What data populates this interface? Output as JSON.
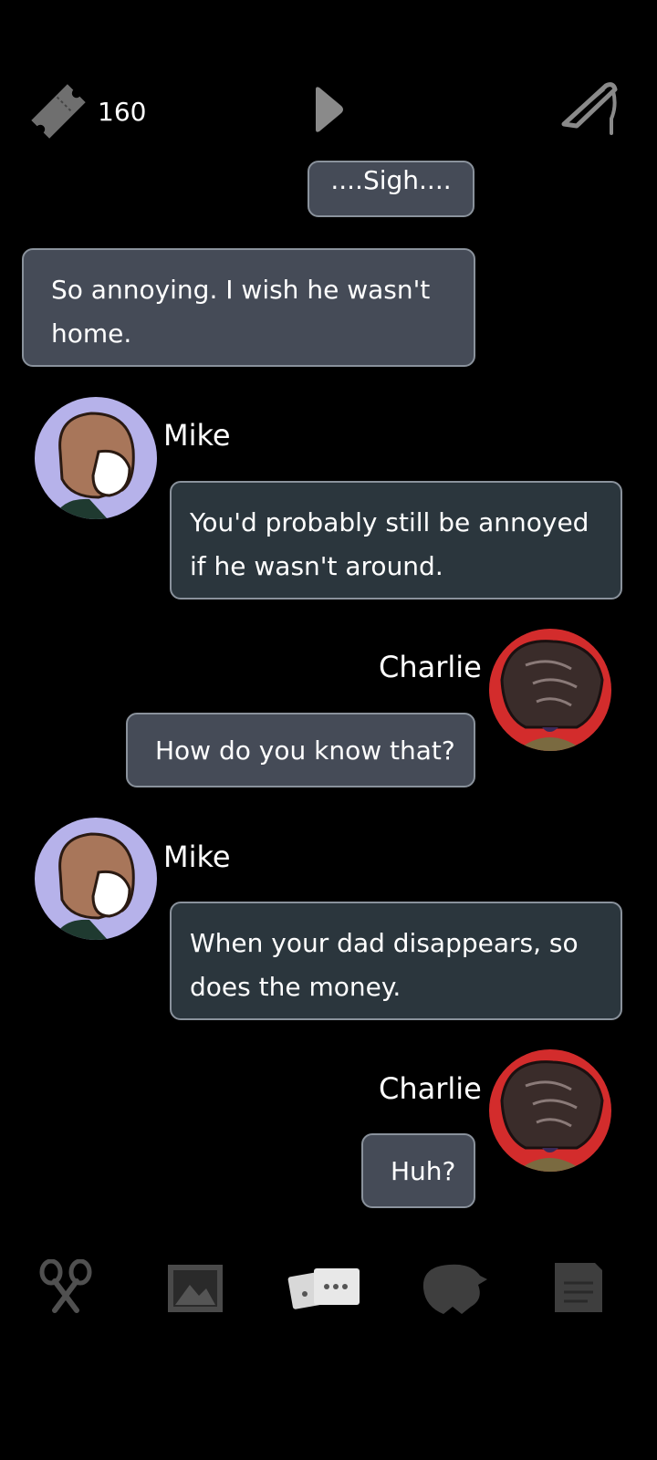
{
  "topbar": {
    "ticket_count": "160",
    "icons": [
      "ticket-icon",
      "play-icon",
      "quill-pen-icon"
    ]
  },
  "chat": {
    "partial_message": "....Sigh....",
    "messages": [
      {
        "speaker": "",
        "side": "self",
        "text": "So annoying. I wish he wasn't\nhome."
      },
      {
        "speaker": "Mike",
        "side": "other",
        "text": "You'd probably still be annoyed\nif he wasn't around."
      },
      {
        "speaker": "Charlie",
        "side": "self",
        "text": "How do you know that?"
      },
      {
        "speaker": "Mike",
        "side": "other",
        "text": "When your dad disappears, so\ndoes the money."
      },
      {
        "speaker": "Charlie",
        "side": "self",
        "text": "Huh?"
      }
    ]
  },
  "bottom_nav": {
    "items": [
      "scissors-icon",
      "photos-icon",
      "chat-icon",
      "character-icon",
      "notes-icon"
    ],
    "active": "chat-icon"
  },
  "colors": {
    "background": "#000000",
    "bubble_self": "#454b57",
    "bubble_other": "#2b363d",
    "bubble_border": "#8a929c",
    "mike_avatar_bg": "#b6b2ea",
    "charlie_avatar_bg": "#d32c2c"
  }
}
